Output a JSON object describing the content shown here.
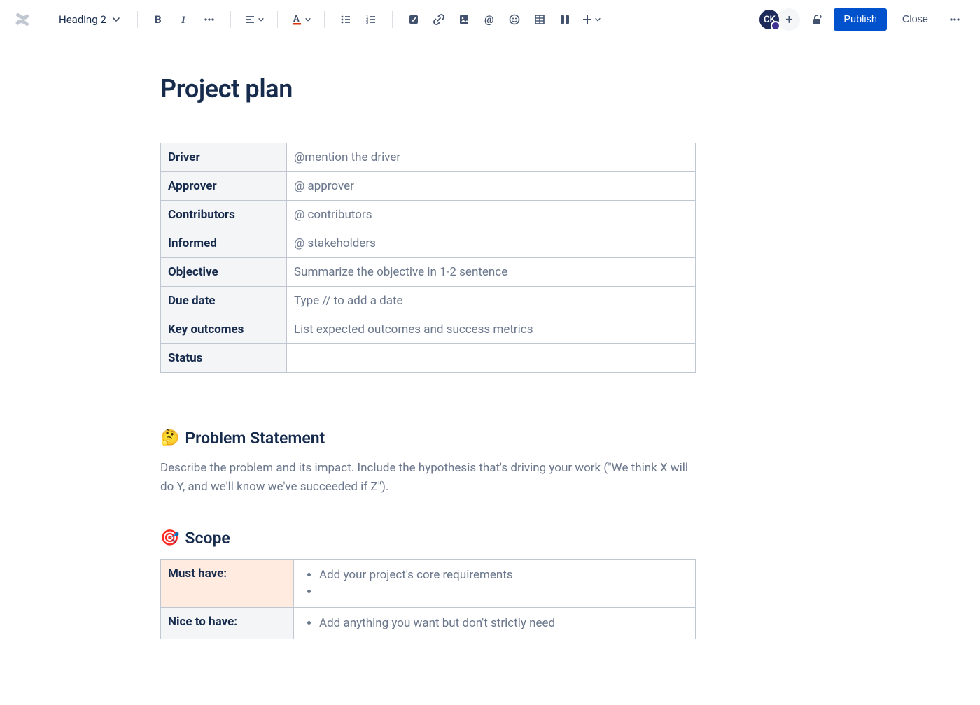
{
  "toolbar": {
    "text_style": "Heading 2",
    "avatar_initials": "CK",
    "publish_label": "Publish",
    "close_label": "Close"
  },
  "doc": {
    "title": "Project plan",
    "metadata_rows": [
      {
        "label": "Driver",
        "placeholder": "@mention the driver"
      },
      {
        "label": "Approver",
        "placeholder": "@ approver"
      },
      {
        "label": "Contributors",
        "placeholder": "@ contributors"
      },
      {
        "label": "Informed",
        "placeholder": "@ stakeholders"
      },
      {
        "label": "Objective",
        "placeholder": "Summarize the objective in 1-2 sentence"
      },
      {
        "label": "Due date",
        "placeholder": "Type // to add a date"
      },
      {
        "label": "Key outcomes",
        "placeholder": "List expected outcomes and success metrics"
      },
      {
        "label": "Status",
        "placeholder": ""
      }
    ],
    "problem_statement": {
      "emoji": "🤔",
      "heading": "Problem Statement",
      "body": "Describe the problem and its impact. Include the hypothesis that's driving your work (\"We think X will do Y, and we'll know we've succeeded if Z\")."
    },
    "scope": {
      "emoji": "🎯",
      "heading": "Scope",
      "must_have_label": "Must have:",
      "must_have_item": "Add your project's core requirements",
      "nice_to_have_label": "Nice to have:",
      "nice_to_have_item": "Add anything you want but don't strictly need"
    }
  }
}
